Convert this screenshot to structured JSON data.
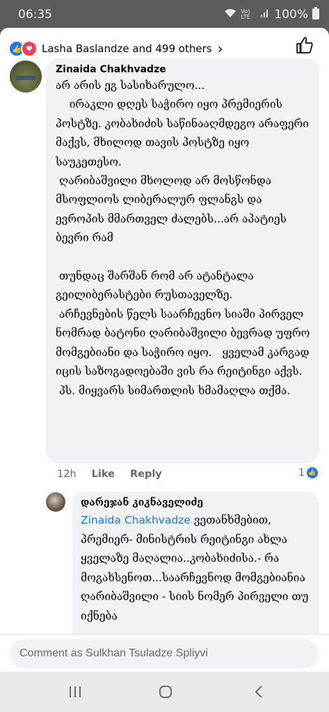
{
  "status": {
    "time": "06:35",
    "battery": "100%",
    "network": "Vo) LTE"
  },
  "header": {
    "reactions_text": "Lasha Baslandze and 499 others",
    "react_icons": [
      "like-icon",
      "love-icon"
    ],
    "chevron": "›"
  },
  "comment1": {
    "author": "Zinaida Chakhvadze",
    "text": "არ არის ეგ სასიხარულო...\n    ირაკლი დღეს საჭირო იყო პრემიერის პოსტზე. კობახიძის საწინააღმდეგო არაფერი მაქვს, მხილოდ თავის პოსტზე იყო საუკეთესო.\n ღარიბაშვილი მხოლოდ არ მოსწონდა მსოფლიოს ლიბერალურ ფლანგს და ევროპის მმართველ ძალებს...არ აპატიეს ბევრი რამ\n\n თუნდაც შარშან რომ არ ატანტალა გეილიბერასტები რუსთაველზე.\n არჩევნების წელს საარჩევნო სიაში პირველ ნომრად ბატონი ღარიბაშვილი ბევრად უფრო მომგებიანი და საჭირო იყო.   ყველამ კარგად იცის საზოგადოებაში ვის რა რეიტინგი აქვს.\n პს. მიყვარს სიმართლის ხმამაღლა თქმა.",
    "time": "12h",
    "like_label": "Like",
    "reply_label": "Reply",
    "like_count": "1"
  },
  "reply1": {
    "author": "დარეჯან კიკნაველიძე",
    "mention": "Zinaida Chakhvadze",
    "text": " ვეთანხმებით, პრემიერ- მინისტრის რეიტინგი ახლა ყველაზე მაღალია..კობახიძისა.- რა მოგახსენოთ...საარჩევნოდ მომგებიანია ღარიბაშვილი - სიის ნომერ პირველი თუ იქნება"
  },
  "composer": {
    "placeholder": "Comment as Sulkhan Tsuladze Spliyvi"
  },
  "colors": {
    "accent": "#1877f2",
    "love": "#f33e58",
    "bubble": "#f0f2f5"
  }
}
